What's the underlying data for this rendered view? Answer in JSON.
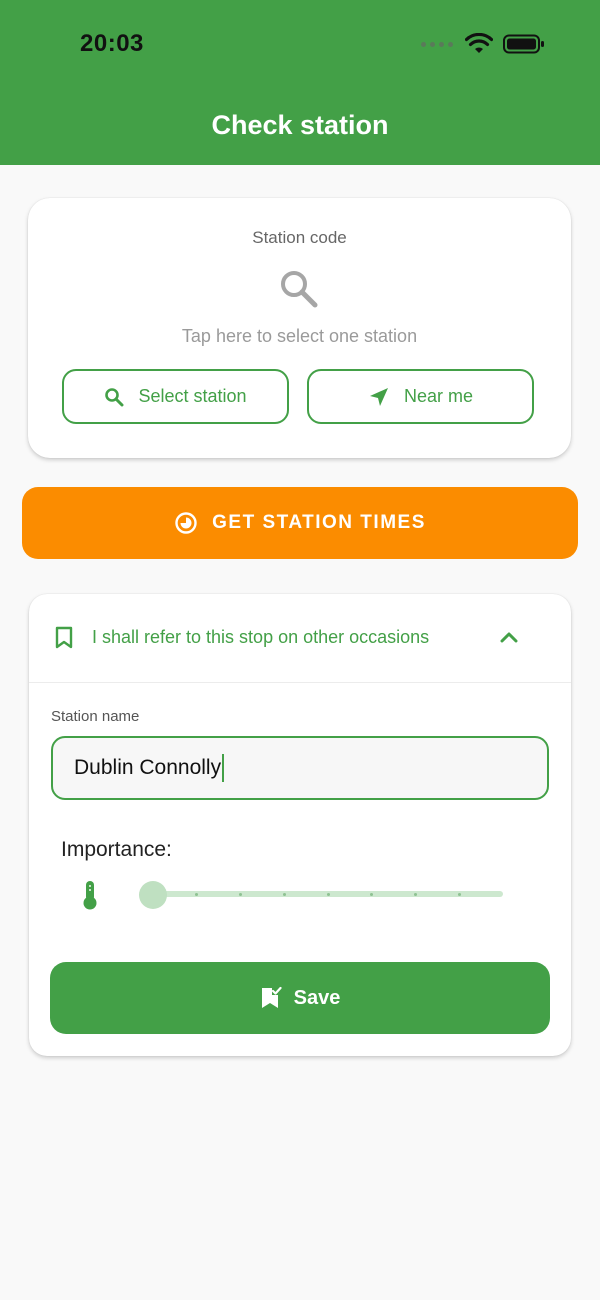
{
  "status_bar": {
    "time": "20:03"
  },
  "header": {
    "title": "Check station"
  },
  "station_card": {
    "label": "Station code",
    "hint": "Tap here to select one station",
    "select_button": "Select station",
    "near_button": "Near me"
  },
  "times_button": {
    "label": "GET STATION TIMES"
  },
  "bookmark": {
    "title": "I shall refer to this stop on other occasions",
    "field_label": "Station name",
    "field_value": "Dublin Connolly",
    "importance_label": "Importance:",
    "importance_fraction": 0,
    "save_label": "Save"
  },
  "colors": {
    "primary": "#43a047",
    "accent": "#fb8c00",
    "background": "#f9f9f9"
  },
  "icons": {
    "wifi": "wifi-icon",
    "battery": "battery-icon",
    "search": "search-icon",
    "navigation": "navigation-arrow-icon",
    "clock": "clock-icon",
    "bookmark": "bookmark-outline-icon",
    "chevron": "chevron-up-icon",
    "thermometer": "thermometer-icon",
    "save": "bookmark-check-icon"
  }
}
